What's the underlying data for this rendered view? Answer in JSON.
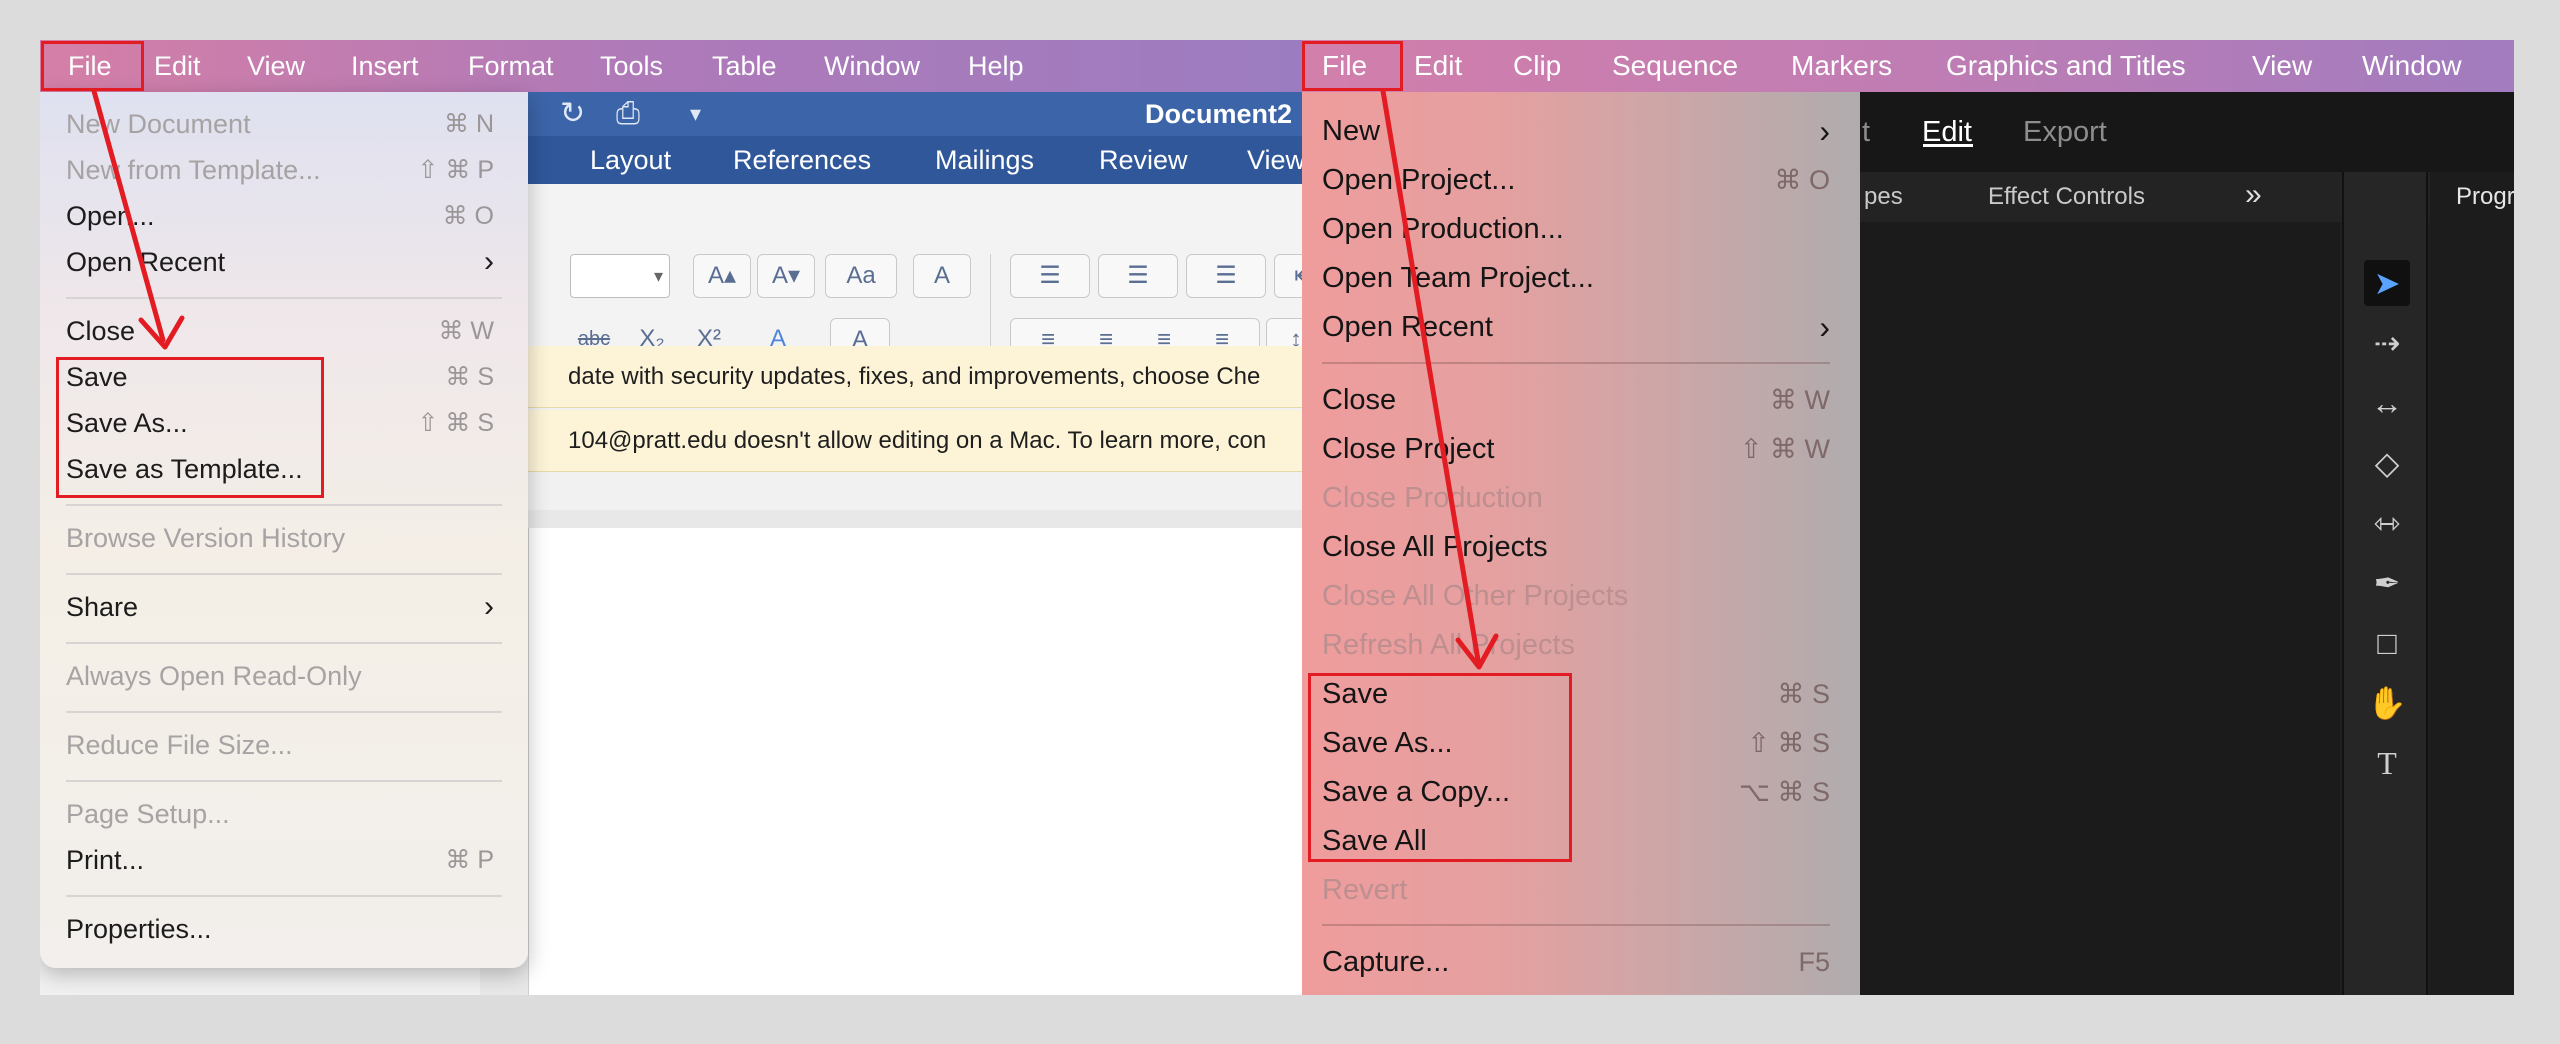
{
  "word": {
    "menubar": [
      "File",
      "Edit",
      "View",
      "Insert",
      "Format",
      "Tools",
      "Table",
      "Window",
      "Help"
    ],
    "doc_title": "Document2",
    "ribbon_tabs": [
      "Layout",
      "References",
      "Mailings",
      "Review",
      "View"
    ],
    "ribbon_buttons": {
      "grow": "A▴",
      "shrink": "A▾",
      "case": "Aa",
      "clear": "A",
      "strike": "abc",
      "sub": "X₂",
      "sup": "X²",
      "effects": "A",
      "color": "A",
      "bullets": "☰",
      "numbering": "☰",
      "multilevel": "☰",
      "outdent": "⇤",
      "align_left": "≡",
      "align_center": "≡",
      "align_right": "≡",
      "justify": "≡",
      "spacing": "↕"
    },
    "notice1": "date with security updates, fixes, and improvements, choose Che",
    "notice2": "104@pratt.edu doesn't allow editing on a Mac. To learn more, con",
    "file_menu": [
      {
        "label": "New Document",
        "shortcut": "⌘ N",
        "disabled": true
      },
      {
        "label": "New from Template...",
        "shortcut": "⇧ ⌘ P",
        "disabled": true
      },
      {
        "label": "Open...",
        "shortcut": "⌘ O"
      },
      {
        "label": "Open Recent",
        "arrow": "›"
      },
      {
        "label": "Close",
        "shortcut": "⌘ W"
      },
      {
        "label": "Save",
        "shortcut": "⌘ S"
      },
      {
        "label": "Save As...",
        "shortcut": "⇧ ⌘ S"
      },
      {
        "label": "Save as Template..."
      },
      {
        "label": "Browse Version History",
        "disabled": true
      },
      {
        "label": "Share",
        "arrow": "›"
      },
      {
        "label": "Always Open Read-Only",
        "disabled": true
      },
      {
        "label": "Reduce File Size...",
        "disabled": true
      },
      {
        "label": "Page Setup...",
        "disabled": true
      },
      {
        "label": "Print...",
        "shortcut": "⌘ P"
      },
      {
        "label": "Properties..."
      }
    ]
  },
  "premiere": {
    "menubar": [
      "File",
      "Edit",
      "Clip",
      "Sequence",
      "Markers",
      "Graphics and Titles",
      "View",
      "Window"
    ],
    "workspaces": [
      "t",
      "Edit",
      "Export"
    ],
    "panels": {
      "partial": "pes",
      "effect_controls": "Effect Controls",
      "more": "»",
      "program": "Program"
    },
    "tools": {
      "selection": "➤",
      "track_select": "⇢",
      "ripple": "↔",
      "razor": "◇",
      "slip": "⇿",
      "pen": "✒",
      "rectangle": "□",
      "hand": "✋",
      "type": "T"
    },
    "file_menu": [
      {
        "label": "New",
        "arrow": "›"
      },
      {
        "label": "Open Project...",
        "shortcut": "⌘ O"
      },
      {
        "label": "Open Production..."
      },
      {
        "label": "Open Team Project..."
      },
      {
        "label": "Open Recent",
        "arrow": "›"
      },
      {
        "label": "Close",
        "shortcut": "⌘ W"
      },
      {
        "label": "Close Project",
        "shortcut": "⇧ ⌘ W"
      },
      {
        "label": "Close Production",
        "disabled": true
      },
      {
        "label": "Close All Projects"
      },
      {
        "label": "Close All Other Projects",
        "disabled": true
      },
      {
        "label": "Refresh All Projects",
        "disabled": true
      },
      {
        "label": "Save",
        "shortcut": "⌘ S"
      },
      {
        "label": "Save As...",
        "shortcut": "⇧ ⌘ S"
      },
      {
        "label": "Save a Copy...",
        "shortcut": "⌥ ⌘ S"
      },
      {
        "label": "Save All"
      },
      {
        "label": "Revert",
        "disabled": true
      },
      {
        "label": "Capture...",
        "shortcut": "F5"
      }
    ]
  },
  "colors": {
    "annotation": "#e31b23",
    "word_blue": "#2f579a",
    "premiere_active_tool": "#5aa4ff"
  }
}
